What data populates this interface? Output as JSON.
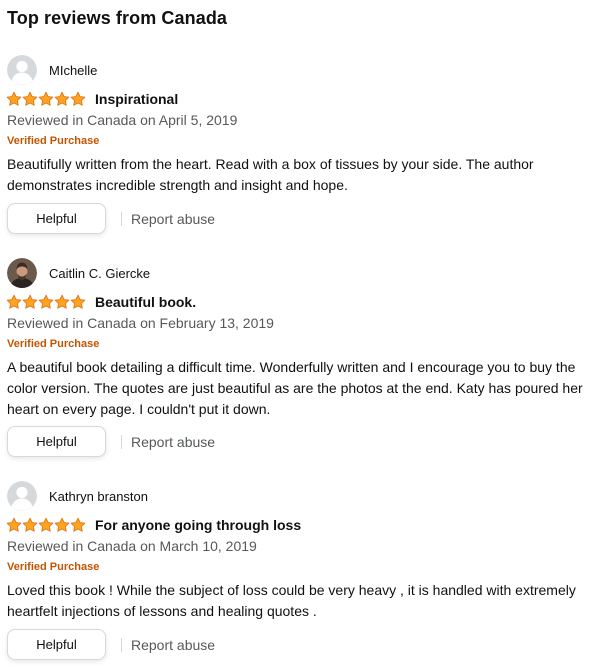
{
  "section_title": "Top reviews from Canada",
  "colors": {
    "star": "#ffa41c",
    "verified": "#c45500",
    "meta": "#565959"
  },
  "reviews": [
    {
      "author": "MIchelle",
      "avatar_icon": "default-user-avatar-icon",
      "rating": 5,
      "title": "Inspirational",
      "date": "Reviewed in Canada on April 5, 2019",
      "verified": "Verified Purchase",
      "body": "Beautifully written from the heart. Read with a box of tissues by your side. The author demonstrates incredible strength and insight and hope.",
      "helpful_label": "Helpful",
      "report_label": "Report abuse"
    },
    {
      "author": "Caitlin C. Giercke",
      "avatar_icon": "user-photo-avatar-icon",
      "rating": 5,
      "title": "Beautiful book.",
      "date": "Reviewed in Canada on February 13, 2019",
      "verified": "Verified Purchase",
      "body": "A beautiful book detailing a difficult time. Wonderfully written and I encourage you to buy the color version. The quotes are just beautiful as are the photos at the end. Katy has poured her heart on every page. I couldn't put it down.",
      "helpful_label": "Helpful",
      "report_label": "Report abuse"
    },
    {
      "author": "Kathryn branston",
      "avatar_icon": "default-user-avatar-icon",
      "rating": 5,
      "title": "For anyone going through loss",
      "date": "Reviewed in Canada on March 10, 2019",
      "verified": "Verified Purchase",
      "body": "Loved this book ! While the subject of loss could be very heavy , it is handled with extremely heartfelt injections of lessons and healing quotes .",
      "helpful_label": "Helpful",
      "report_label": "Report abuse"
    }
  ]
}
